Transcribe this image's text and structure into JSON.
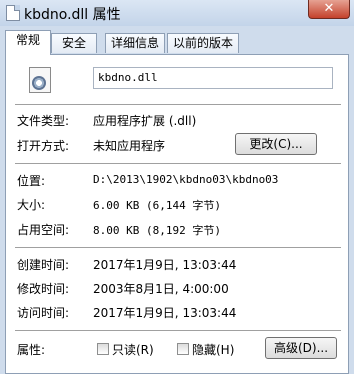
{
  "window": {
    "title": "kbdno.dll 属性",
    "close_glyph": "✕"
  },
  "tabs": [
    {
      "label": "常规"
    },
    {
      "label": "安全"
    },
    {
      "label": "详细信息"
    },
    {
      "label": "以前的版本"
    }
  ],
  "general": {
    "file_name": "kbdno.dll",
    "type_label": "文件类型:",
    "type_value": "应用程序扩展 (.dll)",
    "open_label": "打开方式:",
    "open_value": "未知应用程序",
    "change_button": "更改(C)...",
    "location_label": "位置:",
    "location_value": "D:\\2013\\1902\\kbdno03\\kbdno03",
    "size_label": "大小:",
    "size_value": "6.00 KB (6,144 字节)",
    "disk_label": "占用空间:",
    "disk_value": "8.00 KB (8,192 字节)",
    "created_label": "创建时间:",
    "created_value": "2017年1月9日, 13:03:44",
    "modified_label": "修改时间:",
    "modified_value": "2003年8月1日, 4:00:00",
    "accessed_label": "访问时间:",
    "accessed_value": "2017年1月9日, 13:03:44",
    "attr_label": "属性:",
    "readonly_label": "只读(R)",
    "hidden_label": "隐藏(H)",
    "advanced_button": "高级(D)..."
  },
  "colors": {
    "frame": "#cfdcec",
    "close": "#c4412b"
  }
}
